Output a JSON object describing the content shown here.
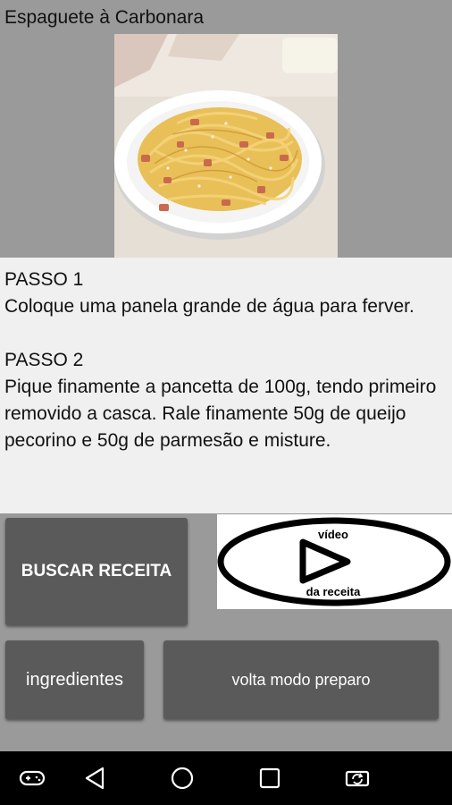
{
  "header": {
    "title": "Espaguete à Carbonara"
  },
  "photo": {
    "icon": "spaghetti-carbonara-photo"
  },
  "steps": [
    {
      "heading": "PASSO 1",
      "text": "Coloque uma panela grande de água para ferver."
    },
    {
      "heading": "PASSO 2",
      "text": "Pique finamente a pancetta de 100g, tendo primeiro removido a casca. Rale finamente 50g de queijo pecorino e 50g de parmesão e misture."
    }
  ],
  "buttons": {
    "buscar": "BUSCAR RECEITA",
    "ingredientes": "ingredientes",
    "volta": "volta modo preparo"
  },
  "video": {
    "top_label": "vídeo",
    "bottom_label": "da receita"
  },
  "nav": {
    "icons": [
      "gamepad-icon",
      "back-icon",
      "home-icon",
      "recents-icon",
      "screen-rotate-icon"
    ]
  },
  "colors": {
    "background": "#9a9a9a",
    "panel": "#f0f0f0",
    "button": "#5a5a5a",
    "navbar": "#000000"
  }
}
